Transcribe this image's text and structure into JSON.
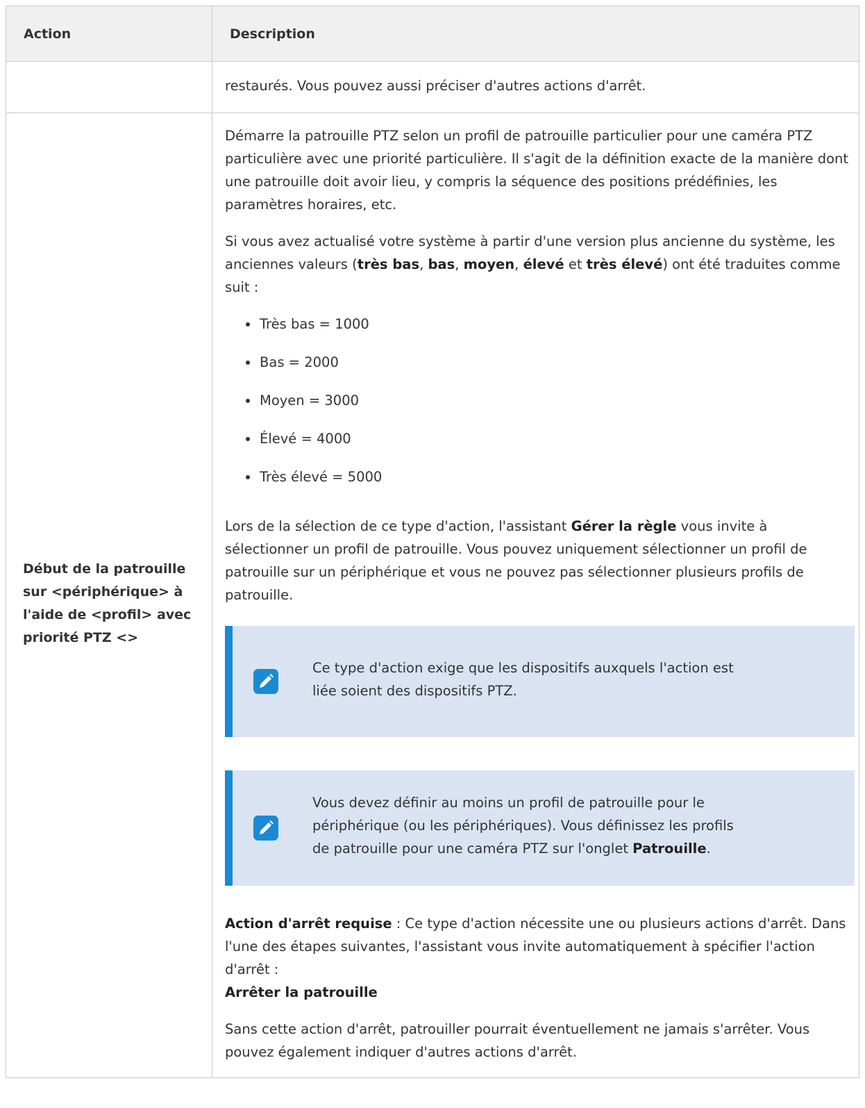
{
  "table": {
    "headers": {
      "action": "Action",
      "description": "Description"
    },
    "continuation_text": "restaurés. Vous pouvez aussi préciser d'autres actions d'arrêt.",
    "row": {
      "action_label": "Début de la patrouille sur <périphérique> à l'aide de <profil> avec priorité PTZ <>",
      "intro_paragraph": "Démarre la patrouille PTZ selon un profil de patrouille particulier pour une caméra PTZ particulière avec une priorité particulière. Il s'agit de la définition exacte de la manière dont une patrouille doit avoir lieu, y compris la séquence des positions prédéfinies, les paramètres horaires, etc.",
      "upgrade_paragraph": {
        "before": "Si vous avez actualisé votre système à partir d'une version plus ancienne du système, les anciennes valeurs (",
        "v1": "très bas",
        "sep1": ", ",
        "v2": "bas",
        "sep2": ", ",
        "v3": "moyen",
        "sep3": ", ",
        "v4": "élevé",
        "sep4": " et ",
        "v5": "très élevé",
        "after": ") ont été traduites comme suit :"
      },
      "bullets": [
        "Très bas = 1000",
        "Bas = 2000",
        "Moyen = 3000",
        "Élevé = 4000",
        "Très élevé = 5000"
      ],
      "wizard_paragraph": {
        "before": "Lors de la sélection de ce type d'action, l'assistant ",
        "bold": "Gérer la règle",
        "after": " vous invite à sélectionner un profil de patrouille. Vous pouvez uniquement sélectionner un profil de patrouille sur un périphérique et vous ne pouvez pas sélectionner plusieurs profils de patrouille."
      },
      "note1": {
        "line1": "Ce type d'action exige que les dispositifs auxquels l'action est",
        "line2": "liée soient des dispositifs PTZ."
      },
      "note2": {
        "line1": "Vous devez définir au moins un profil de patrouille pour le",
        "line2": "périphérique (ou les périphériques). Vous définissez les profils",
        "line3_before": "de patrouille pour une caméra PTZ sur l'onglet ",
        "line3_bold": "Patrouille",
        "line3_after": "."
      },
      "stop_paragraph": {
        "bold": "Action d'arrêt requise",
        "text": " : Ce type d'action nécessite une ou plusieurs actions d'arrêt. Dans l'une des étapes suivantes, l'assistant vous invite automatiquement à spécifier l'action d'arrêt :",
        "stop_action": "Arrêter la patrouille"
      },
      "final_paragraph": "Sans cette action d'arrêt, patrouiller pourrait éventuellement ne jamais s'arrêter. Vous pouvez également indiquer d'autres actions d'arrêt."
    }
  },
  "colors": {
    "note_background": "#dae3f1",
    "note_border": "#1a8ad4",
    "header_background": "#f0f0f0"
  },
  "icons": {
    "note_icon": "pencil-note-icon"
  }
}
